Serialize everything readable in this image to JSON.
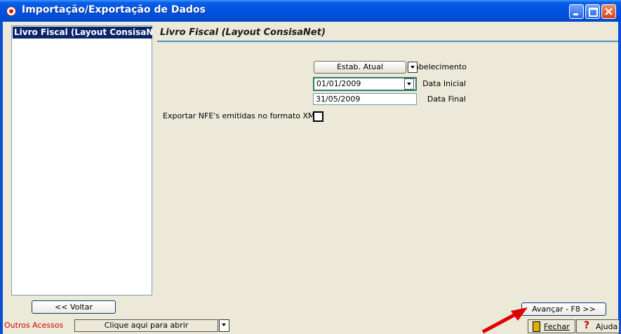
{
  "window": {
    "title": "Importação/Exportação de Dados"
  },
  "left_panel": {
    "items": [
      {
        "label": "Livro Fiscal (Layout ConsisaNet)",
        "selected": true
      }
    ]
  },
  "main": {
    "heading": "Livro Fiscal (Layout ConsisaNet)",
    "estabelecimento": {
      "label": "Estabelecimento",
      "button_label": "Estab. Atual"
    },
    "data_inicial": {
      "label": "Data Inicial",
      "value": "01/01/2009"
    },
    "data_final": {
      "label": "Data Final",
      "value": "31/05/2009"
    },
    "exportar_nfe": {
      "label": "Exportar NFE's emitidas no formato XML",
      "checked": false
    }
  },
  "footer": {
    "voltar_label": "<< Voltar",
    "avancar_label": "Avançar - F8 >>",
    "outros_label": "Outros Acessos",
    "clique_label": "Clique aqui para abrir",
    "fechar_label": "Fechar",
    "ajuda_label": "Ajuda"
  },
  "colors": {
    "titlebar": "#0054e3",
    "selection": "#0a246a",
    "heading_line": "#4a90c8",
    "outros_text": "#d40000",
    "annotation_arrow": "#e00000"
  }
}
